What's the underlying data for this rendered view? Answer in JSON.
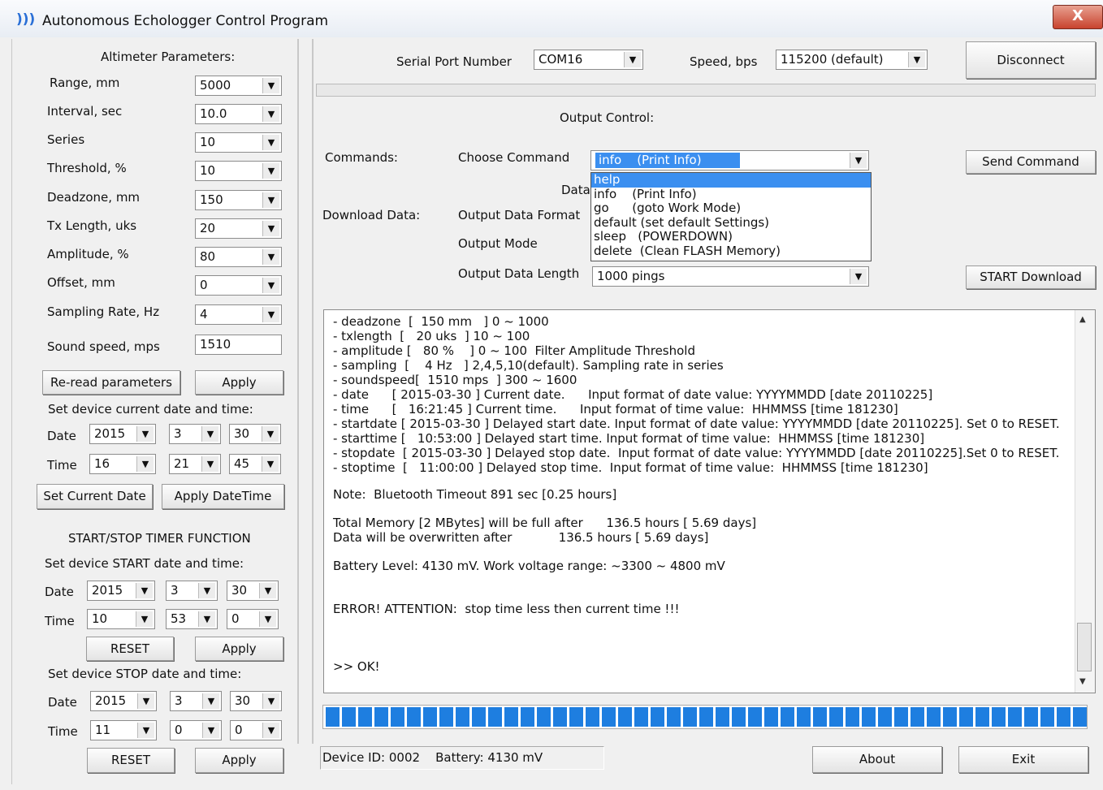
{
  "window": {
    "title": "Autonomous Echologger Control Program",
    "close_label": "X"
  },
  "altimeter": {
    "heading": "Altimeter Parameters:",
    "params": [
      {
        "label": "Range, mm",
        "value": "5000"
      },
      {
        "label": "Interval, sec",
        "value": "10.0"
      },
      {
        "label": "Series",
        "value": "10"
      },
      {
        "label": "Threshold, %",
        "value": "10"
      },
      {
        "label": "Deadzone, mm",
        "value": "150"
      },
      {
        "label": "Tx Length, uks",
        "value": "20"
      },
      {
        "label": "Amplitude, %",
        "value": "80"
      },
      {
        "label": "Offset, mm",
        "value": "0"
      },
      {
        "label": "Sampling Rate, Hz",
        "value": "4"
      }
    ],
    "sound_speed": {
      "label": "Sound speed, mps",
      "value": "1510"
    },
    "reread_label": "Re-read parameters",
    "apply_label": "Apply"
  },
  "current_datetime": {
    "heading": "Set device current date and time:",
    "date_label": "Date",
    "date": [
      "2015",
      "3",
      "30"
    ],
    "time_label": "Time",
    "time": [
      "16",
      "21",
      "45"
    ],
    "set_current_label": "Set Current Date",
    "apply_datetime_label": "Apply DateTime"
  },
  "timer": {
    "heading": "START/STOP TIMER FUNCTION",
    "start_heading": "Set device START date and time:",
    "start_date_label": "Date",
    "start_date": [
      "2015",
      "3",
      "30"
    ],
    "start_time_label": "Time",
    "start_time": [
      "10",
      "53",
      "0"
    ],
    "reset_label": "RESET",
    "apply_label": "Apply",
    "stop_heading": "Set device STOP date and time:",
    "stop_date_label": "Date",
    "stop_date": [
      "2015",
      "3",
      "30"
    ],
    "stop_time_label": "Time",
    "stop_time": [
      "11",
      "0",
      "0"
    ],
    "reset2_label": "RESET",
    "apply2_label": "Apply"
  },
  "serial": {
    "port_label": "Serial Port Number",
    "port_value": "COM16",
    "speed_label": "Speed, bps",
    "speed_value": "115200 (default)",
    "disconnect_label": "Disconnect"
  },
  "output": {
    "heading": "Output Control:",
    "commands_label": "Commands:",
    "choose_label": "Choose Command",
    "command_value": "info    (Print Info)",
    "send_label": "Send Command",
    "data_label": "Data",
    "download_label": "Download Data:",
    "format_label": "Output Data Format",
    "mode_label": "Output Mode",
    "length_label": "Output Data Length",
    "length_value": "1000 pings",
    "start_download_label": "START Download",
    "dropdown_items": [
      "help",
      "info    (Print Info)",
      "go      (goto Work Mode)",
      "default (set default Settings)",
      "sleep   (POWERDOWN)",
      "delete  (Clean FLASH Memory)"
    ]
  },
  "log": {
    "lines": [
      "- deadzone  [  150 mm   ] 0 ~ 1000",
      "- txlength  [   20 uks  ] 10 ~ 100",
      "- amplitude [   80 %    ] 0 ~ 100  Filter Amplitude Threshold",
      "- sampling  [    4 Hz   ] 2,4,5,10(default). Sampling rate in series",
      "- soundspeed[  1510 mps  ] 300 ~ 1600",
      "- date      [ 2015-03-30 ] Current date.      Input format of date value: YYYYMMDD [date 20110225]",
      "- time      [   16:21:45 ] Current time.      Input format of time value:  HHMMSS [time 181230]",
      "- startdate [ 2015-03-30 ] Delayed start date. Input format of date value: YYYYMMDD [date 20110225]. Set 0 to RESET.",
      "- starttime [   10:53:00 ] Delayed start time. Input format of time value:  HHMMSS [time 181230]",
      "- stopdate  [ 2015-03-30 ] Delayed stop date.  Input format of date value: YYYYMMDD [date 20110225].Set 0 to RESET.",
      "- stoptime  [   11:00:00 ] Delayed stop time.  Input format of time value:  HHMMSS [time 181230]"
    ],
    "note": "Note:  Bluetooth Timeout 891 sec [0.25 hours]",
    "memory1": "Total Memory [2 MBytes] will be full after      136.5 hours [ 5.69 days]",
    "memory2": "Data will be overwritten after            136.5 hours [ 5.69 days]",
    "battery": "Battery Level: 4130 mV. Work voltage range: ~3300 ~ 4800 mV",
    "error": "ERROR! ATTENTION:  stop time less then current time !!!",
    "ok": ">> OK!"
  },
  "progress": {
    "value": 1.0
  },
  "status": {
    "text": "Device ID: 0002    Battery: 4130 mV"
  },
  "footer": {
    "about_label": "About",
    "exit_label": "Exit"
  }
}
